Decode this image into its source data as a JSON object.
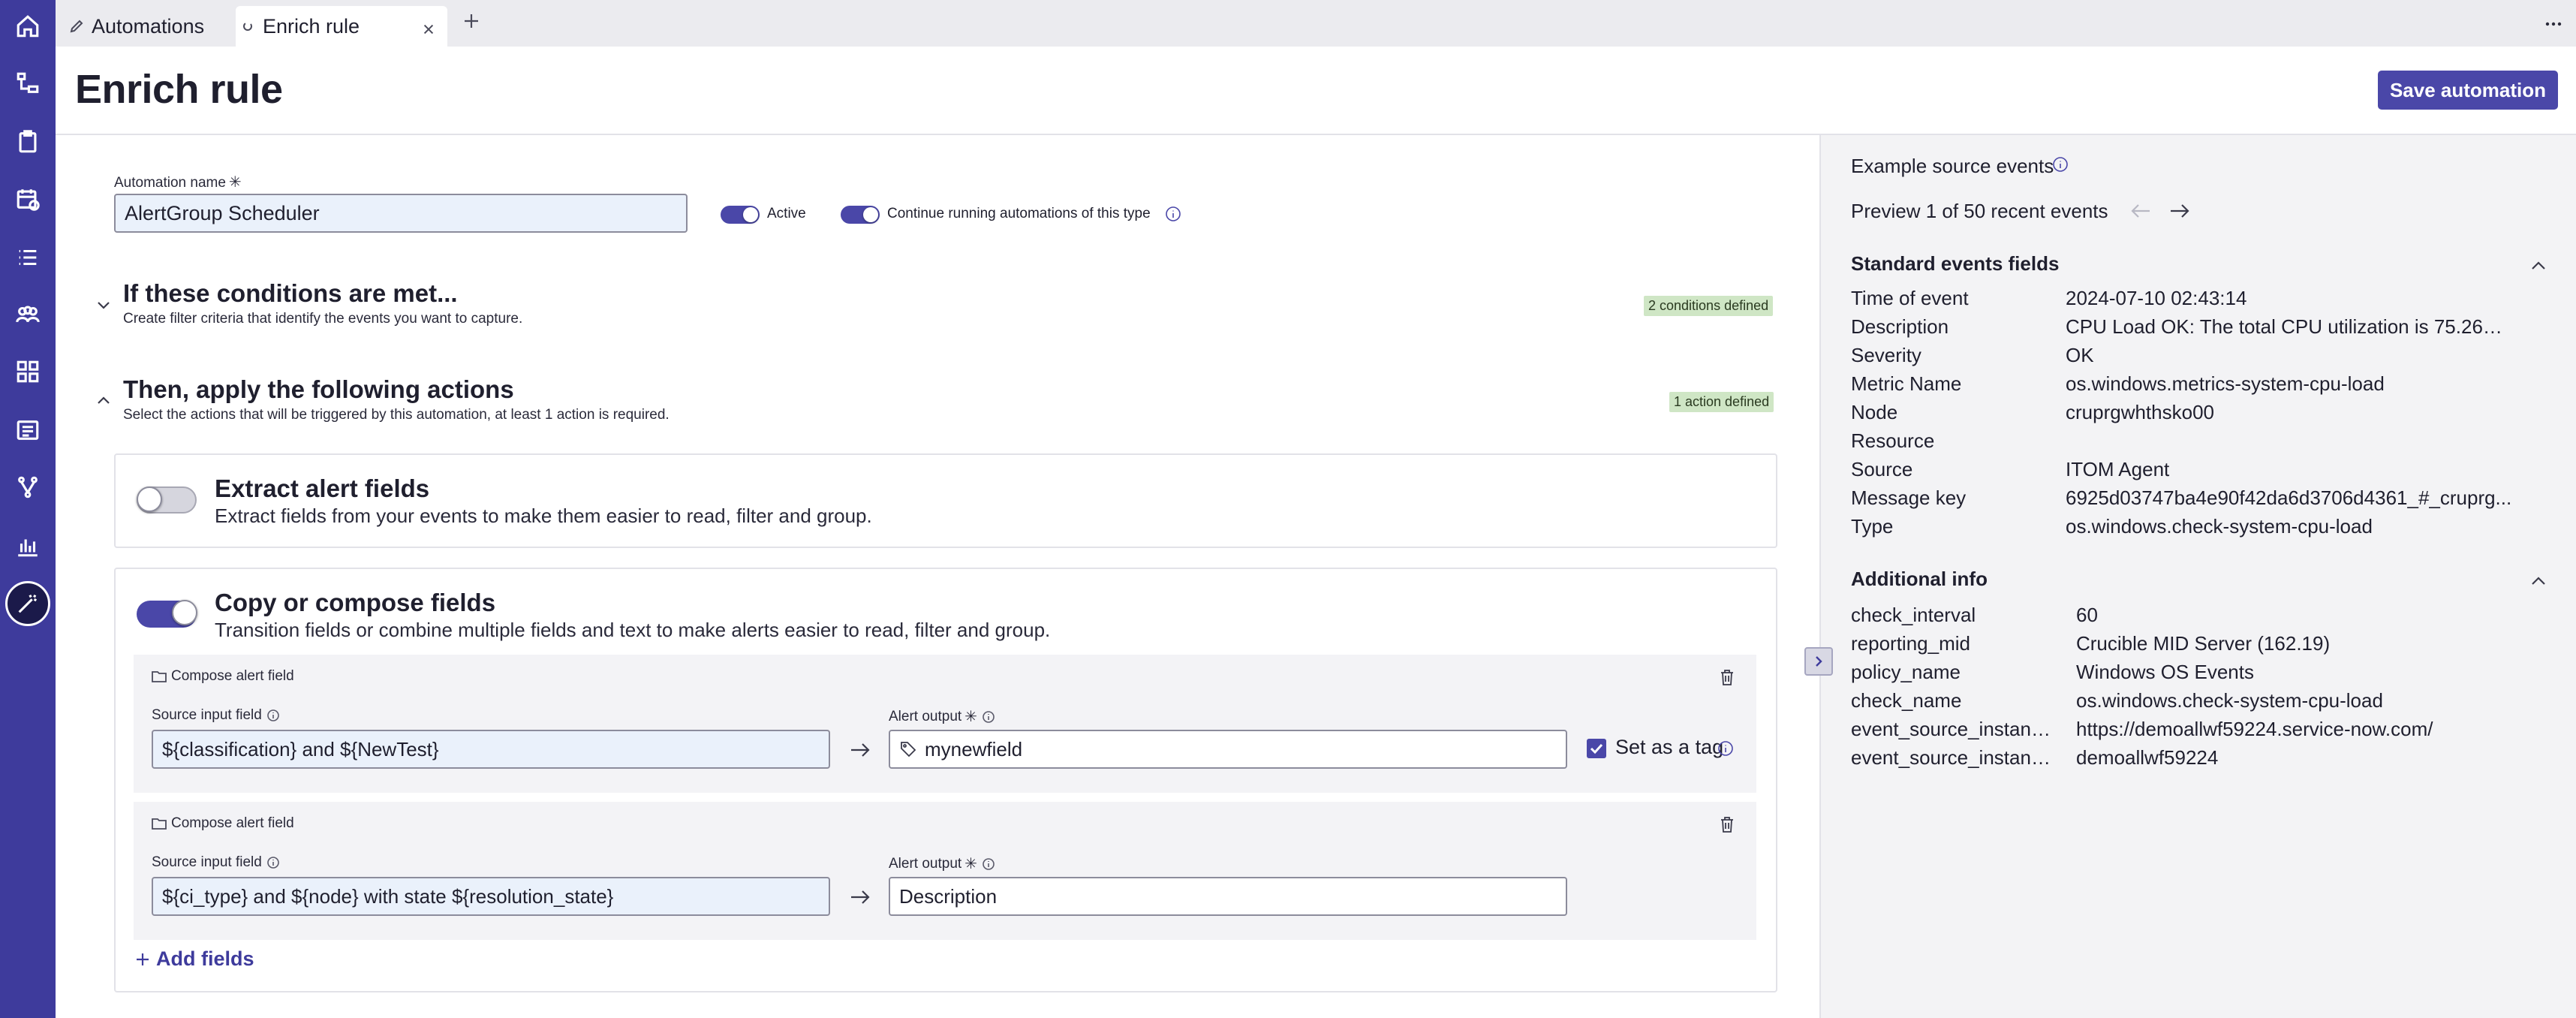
{
  "tabs": [
    {
      "label": "Automations",
      "icon": "pencil-icon"
    },
    {
      "label": "Enrich rule",
      "icon": "loading-icon"
    }
  ],
  "nav_icons": [
    "home-icon",
    "hierarchy-icon",
    "clipboard-icon",
    "calendar-icon",
    "list-icon",
    "group-icon",
    "grid-icon",
    "table-list-icon",
    "branch-icon",
    "chart-icon",
    "automation-wand-icon"
  ],
  "header": {
    "title": "Enrich rule",
    "save_label": "Save automation"
  },
  "form": {
    "name_label": "Automation name",
    "name_value": "AlertGroup Scheduler",
    "active_label": "Active",
    "active_on": true,
    "continue_label": "Continue running automations of this type",
    "continue_on": true
  },
  "conditions": {
    "title": "If these conditions are met...",
    "subtitle": "Create filter criteria that identify the events you want to capture.",
    "badge": "2 conditions defined"
  },
  "actions": {
    "title": "Then, apply the following actions",
    "subtitle": "Select the actions that will be triggered by this automation, at least 1 action is required.",
    "badge": "1 action defined",
    "extract": {
      "title": "Extract alert fields",
      "subtitle": "Extract fields from your events to make them easier to read, filter and group.",
      "enabled": false
    },
    "compose": {
      "title": "Copy or compose fields",
      "subtitle": "Transition fields or combine multiple fields and text to make alerts easier to read, filter and group.",
      "enabled": true,
      "rows": [
        {
          "header": "Compose alert field",
          "source_label": "Source input field",
          "source_value": "${classification} and ${NewTest}",
          "output_label": "Alert output",
          "output_value": "mynewfield",
          "tag_label": "Set as a tag",
          "tag_checked": true
        },
        {
          "header": "Compose alert field",
          "source_label": "Source input field",
          "source_value": "${ci_type} and ${node} with state ${resolution_state}",
          "output_label": "Alert output",
          "output_value": "Description"
        }
      ],
      "add_label": "Add fields"
    }
  },
  "panel": {
    "title": "Example source events",
    "preview": "Preview 1 of 50 recent events",
    "standard_title": "Standard events fields",
    "standard": [
      {
        "k": "Time of event",
        "v": "2024-07-10 02:43:14"
      },
      {
        "k": "Description",
        "v": "CPU Load OK: The total CPU utilization is 75.26% . ..."
      },
      {
        "k": "Severity",
        "v": "OK"
      },
      {
        "k": "Metric Name",
        "v": "os.windows.metrics-system-cpu-load"
      },
      {
        "k": "Node",
        "v": "cruprgwhthsko00"
      },
      {
        "k": "Resource",
        "v": ""
      },
      {
        "k": "Source",
        "v": "ITOM Agent"
      },
      {
        "k": "Message key",
        "v": "6925d03747ba4e90f42da6d3706d4361_#_cruprg..."
      },
      {
        "k": "Type",
        "v": "os.windows.check-system-cpu-load"
      }
    ],
    "additional_title": "Additional info",
    "additional": [
      {
        "k": "check_interval",
        "v": "60"
      },
      {
        "k": "reporting_mid",
        "v": "Crucible MID Server (162.19)"
      },
      {
        "k": "policy_name",
        "v": "Windows OS Events"
      },
      {
        "k": "check_name",
        "v": "os.windows.check-system-cpu-load"
      },
      {
        "k": "event_source_instance...",
        "v": "https://demoallwf59224.service-now.com/"
      },
      {
        "k": "event_source_instance...",
        "v": "demoallwf59224"
      }
    ]
  },
  "colors": {
    "rail": "#3e3b9c",
    "accent": "#4a47a8",
    "badge": "#cfe6c5",
    "panel": "#f3f3f5"
  }
}
